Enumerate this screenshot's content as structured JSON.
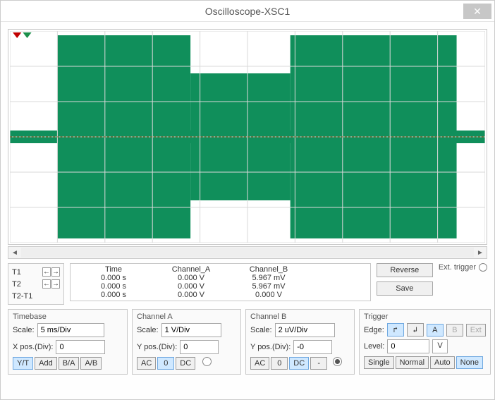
{
  "window": {
    "title": "Oscilloscope-XSC1"
  },
  "scope": {
    "rows": 6,
    "cols": 10,
    "center_line_color": "#a85c2a",
    "wave_color": "#108f5b",
    "bg_color": "#ffffff",
    "grid_color": "#d8d8d8",
    "blocks": [
      {
        "start_col": 1.0,
        "end_col": 3.8,
        "top": 0.02,
        "bottom": 0.98
      },
      {
        "start_col": 3.8,
        "end_col": 5.9,
        "top": 0.2,
        "bottom": 0.8
      },
      {
        "start_col": 5.9,
        "end_col": 9.4,
        "top": 0.02,
        "bottom": 0.98
      }
    ],
    "thin_band": {
      "top": 0.47,
      "bottom": 0.53
    },
    "marker_colors": [
      "#c00000",
      "#1b8f4a"
    ]
  },
  "cursors": {
    "labels": {
      "t1": "T1",
      "t2": "T2",
      "diff": "T2-T1"
    }
  },
  "readout": {
    "headers": {
      "time": "Time",
      "cha": "Channel_A",
      "chb": "Channel_B"
    },
    "rows": [
      {
        "time": "0.000 s",
        "cha": "0.000 V",
        "chb": "5.967 mV"
      },
      {
        "time": "0.000 s",
        "cha": "0.000 V",
        "chb": "5.967 mV"
      },
      {
        "time": "0.000 s",
        "cha": "0.000 V",
        "chb": "0.000 V"
      }
    ]
  },
  "buttons": {
    "reverse": "Reverse",
    "save": "Save"
  },
  "ext_trigger_label": "Ext. trigger",
  "timebase": {
    "title": "Timebase",
    "scale_label": "Scale:",
    "scale_value": "5 ms/Div",
    "xpos_label": "X pos.(Div):",
    "xpos_value": "0",
    "btns": {
      "yt": "Y/T",
      "add": "Add",
      "ba": "B/A",
      "ab": "A/B"
    }
  },
  "channel_a": {
    "title": "Channel A",
    "scale_label": "Scale:",
    "scale_value": "1 V/Div",
    "ypos_label": "Y pos.(Div):",
    "ypos_value": "0",
    "btns": {
      "ac": "AC",
      "zero": "0",
      "dc": "DC"
    }
  },
  "channel_b": {
    "title": "Channel B",
    "scale_label": "Scale:",
    "scale_value": "2 uV/Div",
    "ypos_label": "Y pos.(Div):",
    "ypos_value": "-0",
    "btns": {
      "ac": "AC",
      "zero": "0",
      "dc": "DC",
      "minus": "-"
    }
  },
  "trigger": {
    "title": "Trigger",
    "edge_label": "Edge:",
    "edge_btns": {
      "rise": "↱",
      "fall": "↲",
      "a": "A",
      "b": "B",
      "ext": "Ext"
    },
    "level_label": "Level:",
    "level_value": "0",
    "level_unit": "V",
    "mode_btns": {
      "single": "Single",
      "normal": "Normal",
      "auto": "Auto",
      "none": "None"
    }
  }
}
